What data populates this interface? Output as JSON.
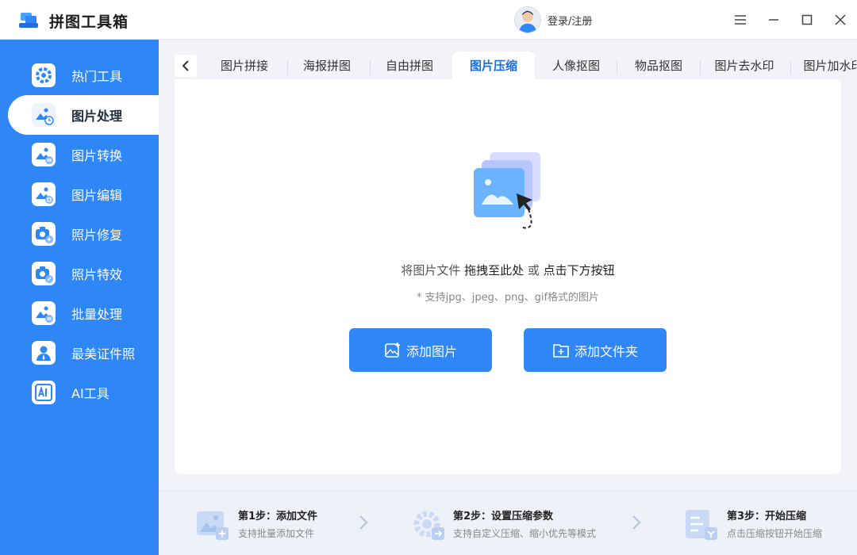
{
  "app": {
    "title": "拼图工具箱"
  },
  "header": {
    "login_label": "登录/注册"
  },
  "sidebar": {
    "items": [
      {
        "label": "热门工具",
        "icon": "gear-tools-icon"
      },
      {
        "label": "图片处理",
        "icon": "image-clock-icon",
        "active": true
      },
      {
        "label": "图片转换",
        "icon": "image-convert-icon"
      },
      {
        "label": "图片编辑",
        "icon": "image-edit-icon"
      },
      {
        "label": "照片修复",
        "icon": "camera-plus-icon"
      },
      {
        "label": "照片特效",
        "icon": "camera-wand-icon"
      },
      {
        "label": "批量处理",
        "icon": "image-batch-icon"
      },
      {
        "label": "最美证件照",
        "icon": "id-photo-icon"
      },
      {
        "label": "AI工具",
        "icon": "ai-icon"
      }
    ]
  },
  "tabs": [
    {
      "label": "图片拼接"
    },
    {
      "label": "海报拼图"
    },
    {
      "label": "自由拼图"
    },
    {
      "label": "图片压缩",
      "active": true
    },
    {
      "label": "人像抠图"
    },
    {
      "label": "物品抠图"
    },
    {
      "label": "图片去水印"
    },
    {
      "label": "图片加水印"
    }
  ],
  "main": {
    "hint_prefix": "将图片文件 ",
    "hint_drag": "拖拽至此处",
    "hint_or": " 或 ",
    "hint_click": "点击下方按钮",
    "format_hint": "* 支持jpg、jpeg、png、gif格式的图片",
    "add_image_label": "添加图片",
    "add_folder_label": "添加文件夹"
  },
  "steps": [
    {
      "title": "第1步：添加文件",
      "desc": "支持批量添加文件"
    },
    {
      "title": "第2步：设置压缩参数",
      "desc": "支持自定义压缩、缩小优先等模式"
    },
    {
      "title": "第3步：开始压缩",
      "desc": "点击压缩按钮开始压缩"
    }
  ],
  "colors": {
    "accent": "#2f86f6",
    "active_tab_text": "#1a6fe0",
    "background": "#f1f3f8"
  }
}
